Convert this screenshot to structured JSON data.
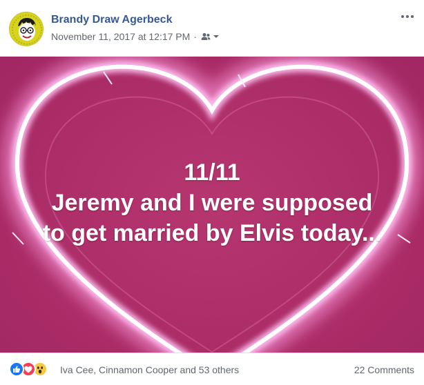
{
  "post": {
    "author": "Brandy Draw Agerbeck",
    "timestamp": "November 11, 2017 at 12:17 PM",
    "separator": "·",
    "privacy_icon": "friends-icon",
    "more_icon": "more-horizontal-icon"
  },
  "image": {
    "line1": "11/11",
    "line2": "Jeremy and I were supposed",
    "line3": "to get married by Elvis today..."
  },
  "footer": {
    "reactions": [
      "like-reaction-icon",
      "love-reaction-icon",
      "wow-reaction-icon"
    ],
    "reaction_names": "Iva Cee, Cinnamon Cooper and 53 others",
    "comments": "22 Comments"
  },
  "colors": {
    "author_link": "#365899",
    "image_background": "#b0306c",
    "like": "#1877f2",
    "love": "#f33e58",
    "wow": "#f7c844"
  }
}
